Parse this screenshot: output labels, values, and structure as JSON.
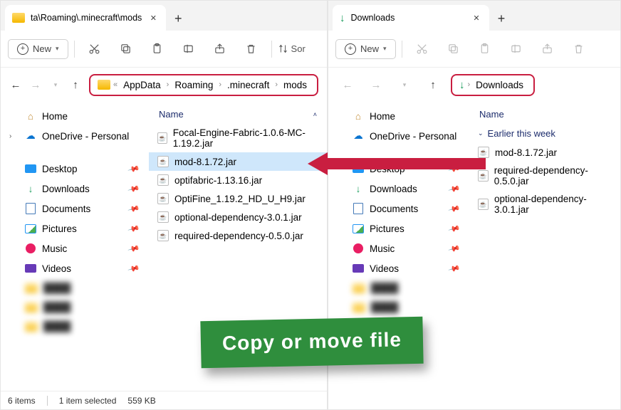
{
  "left": {
    "tab_title": "ta\\Roaming\\.minecraft\\mods",
    "new_label": "New",
    "sort_label": "Sor",
    "breadcrumb": [
      "AppData",
      "Roaming",
      ".minecraft",
      "mods"
    ],
    "breadcrumb_prefix": "«",
    "col_name": "Name",
    "sidebar": {
      "home": "Home",
      "onedrive": "OneDrive - Personal",
      "desktop": "Desktop",
      "downloads": "Downloads",
      "documents": "Documents",
      "pictures": "Pictures",
      "music": "Music",
      "videos": "Videos"
    },
    "files": [
      "Focal-Engine-Fabric-1.0.6-MC-1.19.2.jar",
      "mod-8.1.72.jar",
      "optifabric-1.13.16.jar",
      "OptiFine_1.19.2_HD_U_H9.jar",
      "optional-dependency-3.0.1.jar",
      "required-dependency-0.5.0.jar"
    ],
    "selected_index": 1,
    "status": {
      "count": "6 items",
      "selected": "1 item selected",
      "size": "559 KB"
    }
  },
  "right": {
    "tab_title": "Downloads",
    "new_label": "New",
    "breadcrumb_label": "Downloads",
    "col_name": "Name",
    "group_label": "Earlier this week",
    "sidebar": {
      "home": "Home",
      "onedrive": "OneDrive - Personal",
      "desktop": "Desktop",
      "downloads": "Downloads",
      "documents": "Documents",
      "pictures": "Pictures",
      "music": "Music",
      "videos": "Videos"
    },
    "files": [
      "mod-8.1.72.jar",
      "required-dependency-0.5.0.jar",
      "optional-dependency-3.0.1.jar"
    ]
  },
  "banner": "Copy or move file"
}
